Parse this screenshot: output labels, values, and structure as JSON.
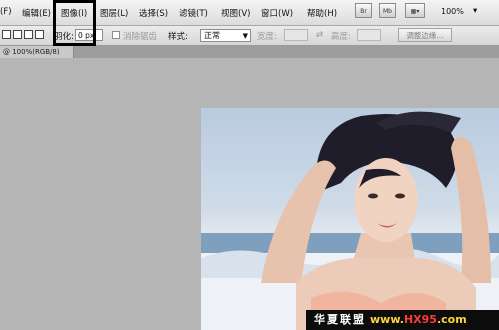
{
  "menubar": {
    "items": [
      "(F)",
      "编辑(E)",
      "图像(I)",
      "图层(L)",
      "选择(S)",
      "滤镜(T)",
      "视图(V)",
      "窗口(W)",
      "帮助(H)"
    ],
    "app_buttons": [
      "Br",
      "Mb"
    ],
    "zoom": "100%"
  },
  "options": {
    "feather_label": "羽化:",
    "feather_value": "0 px",
    "antialias_label": "消除锯齿",
    "style_label": "样式:",
    "style_value": "正常",
    "width_label": "宽度:",
    "height_label": "高度:",
    "refine_edge": "调整边缘..."
  },
  "document": {
    "tab_label": "@ 100%(RGB/8)"
  },
  "watermark": {
    "text": "华夏联盟",
    "url_prefix": "www.",
    "url_highlight": "HX95",
    "url_suffix": ".com"
  }
}
